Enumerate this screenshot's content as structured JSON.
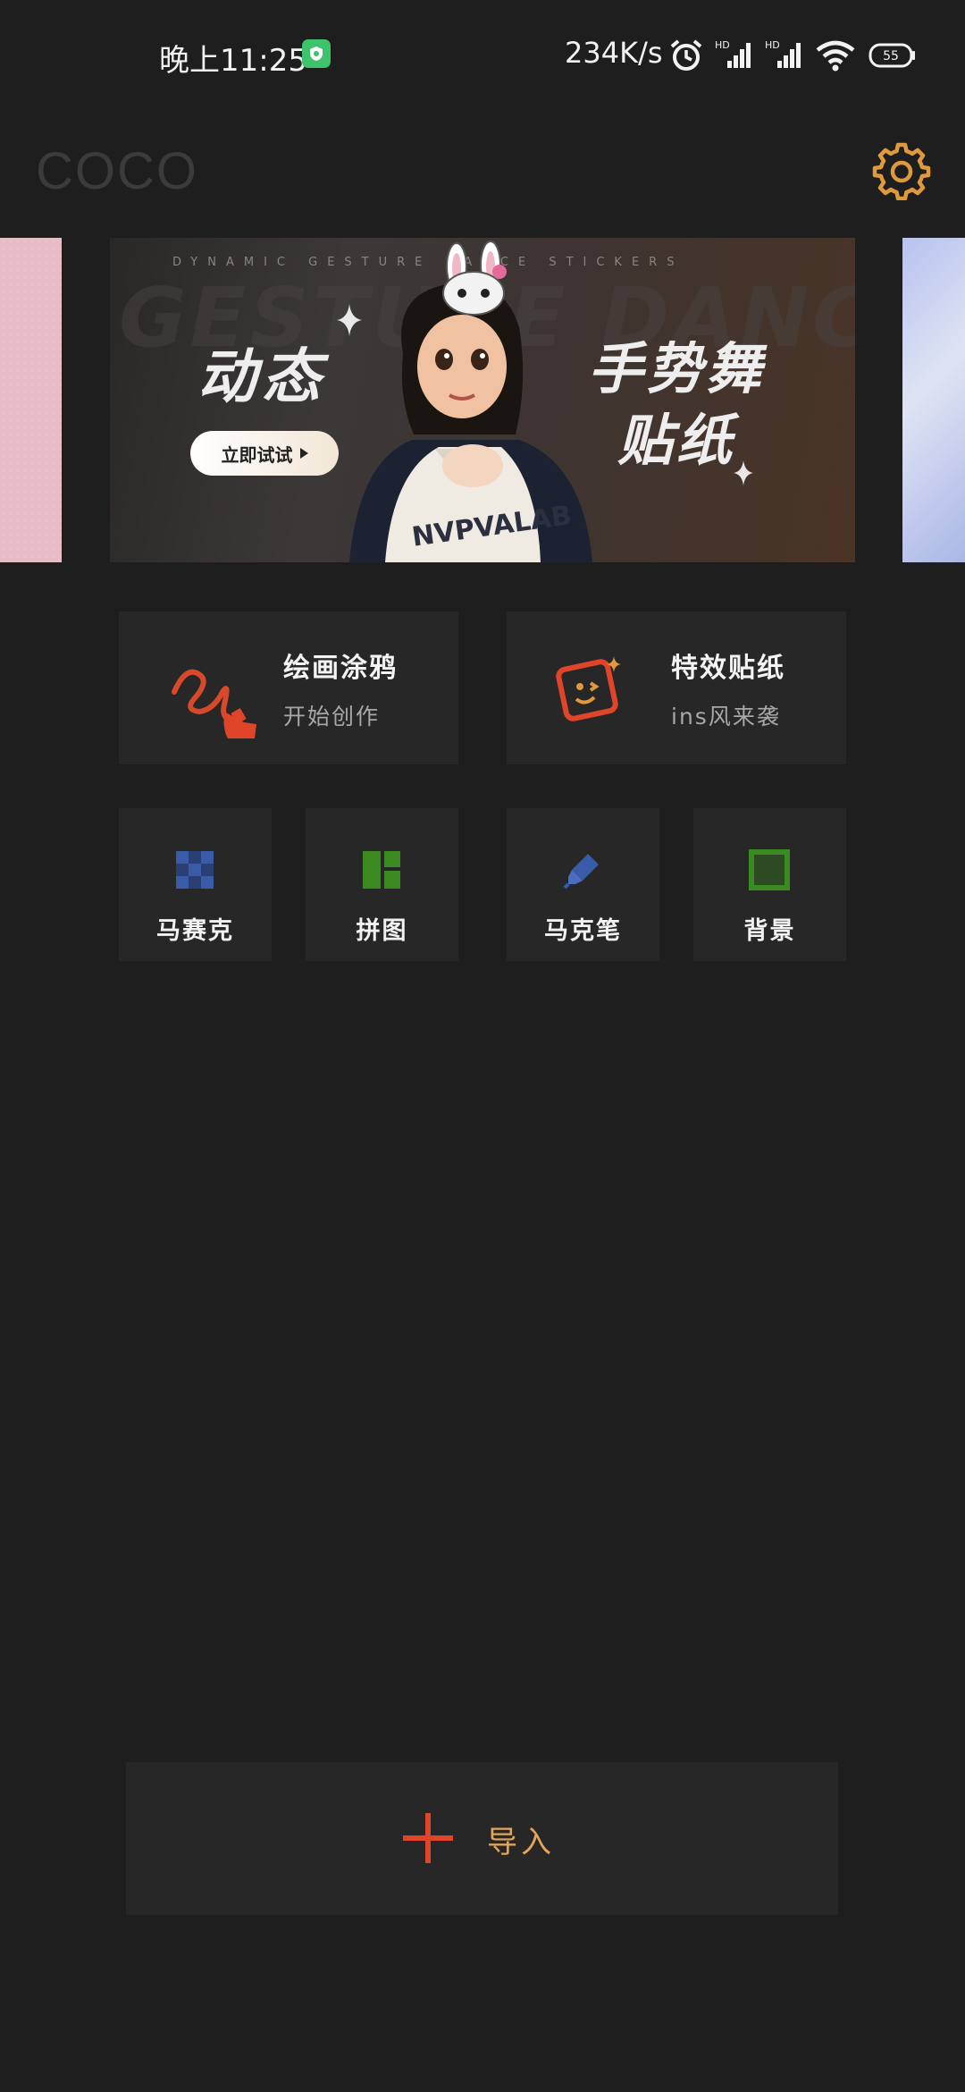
{
  "status_bar": {
    "time": "晚上11:25",
    "net_speed": "234K/s",
    "battery": "55",
    "icons": [
      "shield-app-icon",
      "alarm-icon",
      "signal-hd-1-icon",
      "signal-hd-2-icon",
      "wifi-icon",
      "battery-icon"
    ]
  },
  "header": {
    "app_name": "COCO",
    "settings_icon": "gear-icon",
    "accent_color": "#e09a3e"
  },
  "banner": {
    "top_text": "DYNAMIC GESTURE DANCE STICKERS",
    "bg_text": "GESTURE DANC",
    "title_left": "动态",
    "title_right_1": "手势舞",
    "title_right_2": "贴纸",
    "cta": "立即试试"
  },
  "features": {
    "drawing": {
      "title": "绘画涂鸦",
      "subtitle": "开始创作",
      "icon": "scribble-brush-icon"
    },
    "stickers": {
      "title": "特效贴纸",
      "subtitle": "ins风来袭",
      "icon": "sticker-face-icon"
    }
  },
  "tools": [
    {
      "label": "马赛克",
      "icon": "mosaic-icon",
      "color": "#3a5ba8"
    },
    {
      "label": "拼图",
      "icon": "collage-icon",
      "color": "#3c8a22"
    },
    {
      "label": "马克笔",
      "icon": "marker-icon",
      "color": "#3a5ba8"
    },
    {
      "label": "背景",
      "icon": "background-square-icon",
      "color": "#3c8a22"
    }
  ],
  "import": {
    "label": "导入",
    "icon": "plus-icon",
    "plus_color": "#e0452a",
    "label_color": "#e2a55a"
  }
}
